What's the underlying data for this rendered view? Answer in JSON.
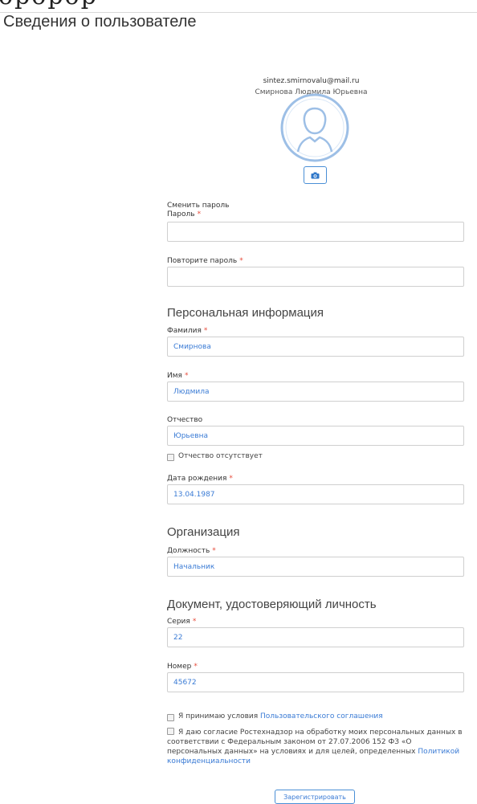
{
  "cut_glyph": "opopop",
  "page_title": "Сведения о пользователе",
  "user": {
    "email": "sintez.smirnovalu@mail.ru",
    "full_name": "Смирнова Людмила Юрьевна"
  },
  "password": {
    "change_label": "Сменить пароль",
    "password_label": "Пароль",
    "password_value": "",
    "repeat_label": "Повторите пароль",
    "repeat_value": ""
  },
  "personal": {
    "section_title": "Персональная информация",
    "last_name_label": "Фамилия",
    "last_name_value": "Смирнова",
    "first_name_label": "Имя",
    "first_name_value": "Людмила",
    "middle_name_label": "Отчество",
    "middle_name_value": "Юрьевна",
    "no_middle_name_label": "Отчество отсутствует",
    "birth_date_label": "Дата рождения",
    "birth_date_value": "13.04.1987"
  },
  "organization": {
    "section_title": "Организация",
    "position_label": "Должность",
    "position_value": "Начальник"
  },
  "document": {
    "section_title": "Документ, удостоверяющий личность",
    "series_label": "Серия",
    "series_value": "22",
    "number_label": "Номер",
    "number_value": "45672"
  },
  "agreements": {
    "terms_prefix": "Я принимаю условия ",
    "terms_link": "Пользовательского соглашения",
    "consent_text": "Я даю согласие Ростехнадзор на обработку моих персональных данных в соответствии с Федеральным законом от 27.07.2006 152 ФЗ «О персональных данных» на условиях и для целей, определенных ",
    "privacy_link": "Политикой конфиденциальности"
  },
  "submit_label": "Зарегистрировать",
  "required_mark": "*",
  "icons": {
    "avatar": "user-silhouette-icon",
    "photo": "camera-icon"
  },
  "colors": {
    "accent": "#3a7bd5",
    "required": "#e74c3c",
    "border": "#cfcfcf"
  }
}
